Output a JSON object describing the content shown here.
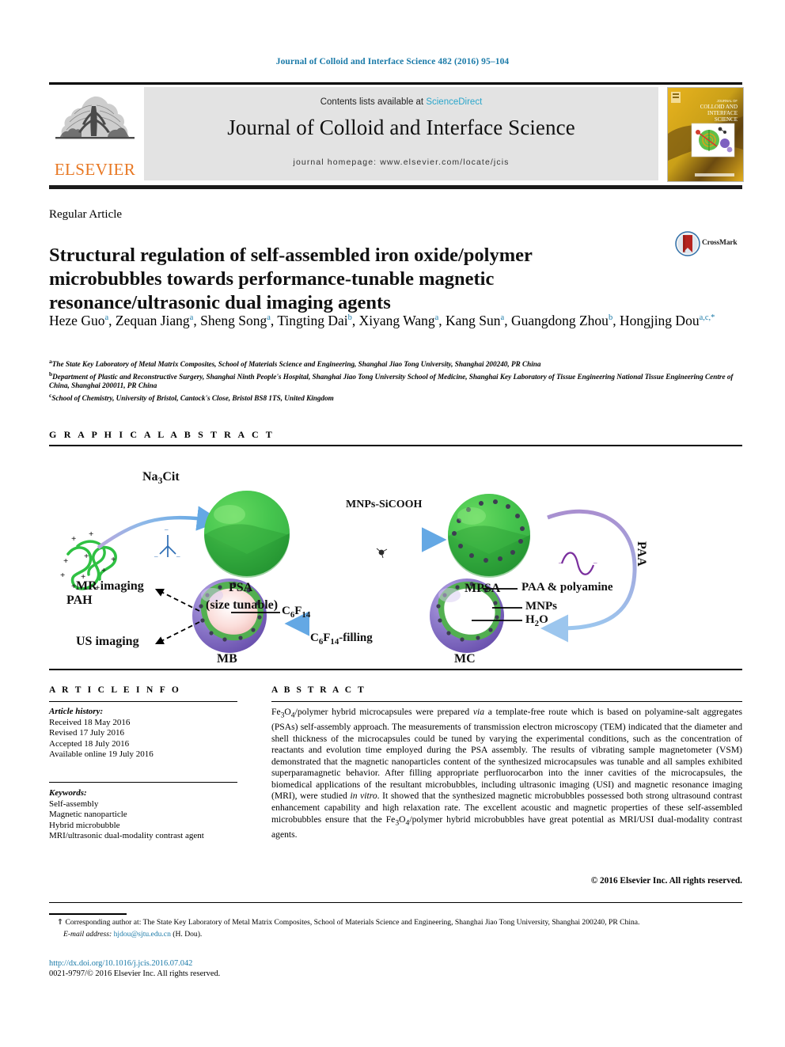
{
  "running_head": "Journal of Colloid and Interface Science 482 (2016) 95–104",
  "masthead": {
    "publisher": "ELSEVIER",
    "contents_prefix": "Contents lists available at ",
    "contents_link": "ScienceDirect",
    "journal_title": "Journal of Colloid and Interface Science",
    "homepage": "journal homepage: www.elsevier.com/locate/jcis",
    "cover_line1": "COLLOID AND",
    "cover_line2": "INTERFACE",
    "cover_line3": "SCIENCE"
  },
  "article": {
    "type": "Regular Article",
    "title": "Structural regulation of self-assembled iron oxide/polymer microbubbles towards performance-tunable magnetic resonance/ultrasonic dual imaging agents",
    "crossmark_label": "CrossMark"
  },
  "authors": [
    {
      "name": "Heze Guo",
      "sup": "a",
      "sep": ", "
    },
    {
      "name": "Zequan Jiang",
      "sup": "a",
      "sep": ", "
    },
    {
      "name": "Sheng Song",
      "sup": "a",
      "sep": ", "
    },
    {
      "name": "Tingting Dai",
      "sup": "b",
      "sep": ", "
    },
    {
      "name": "Xiyang Wang",
      "sup": "a",
      "sep": ", "
    },
    {
      "name": "Kang Sun",
      "sup": "a",
      "sep": ", "
    },
    {
      "name": "Guangdong Zhou",
      "sup": "b",
      "sep": ", "
    },
    {
      "name": "Hongjing Dou",
      "sup": "a,c,*",
      "sep": ""
    }
  ],
  "affiliations": [
    {
      "mark": "a",
      "text": "The State Key Laboratory of Metal Matrix Composites, School of Materials Science and Engineering, Shanghai Jiao Tong University, Shanghai 200240, PR China"
    },
    {
      "mark": "b",
      "text": "Department of Plastic and Reconstructive Surgery, Shanghai Ninth People's Hospital, Shanghai Jiao Tong University School of Medicine, Shanghai Key Laboratory of Tissue Engineering National Tissue Engineering Centre of China, Shanghai 200011, PR China"
    },
    {
      "mark": "c",
      "text": "School of Chemistry, University of Bristol, Cantock's Close, Bristol BS8 1TS, United Kingdom"
    }
  ],
  "graphical_abstract": {
    "heading": "G R A P H I C A L   A B S T R A C T",
    "labels": {
      "pah": "PAH",
      "na3cit": "Na3Cit",
      "psa": "PSA",
      "psa_sub": "(size tunable)",
      "mnps_sicooh": "MNPs-SiCOOH",
      "mpsa": "MPSA",
      "paa": "PAA",
      "mc": "MC",
      "mb": "MB",
      "paa_polyamine": "PAA & polyamine",
      "mnps": "MNPs",
      "h2o": "H2O",
      "c6f14": "C6F14",
      "c6f14_filling": "C6F14-filling",
      "mr_imaging": "MR imaging",
      "us_imaging": "US imaging"
    },
    "colors": {
      "green": "#3cb847",
      "green_dark": "#2e9a38",
      "purple": "#8a76c8",
      "arrow_blue": "#7ab4e8",
      "arrow_purple": "#9a6fc0",
      "pink": "#f3c9c6"
    }
  },
  "article_info": {
    "heading": "A R T I C L E   I N F O",
    "history_label": "Article history:",
    "history": [
      "Received 18 May 2016",
      "Revised 17 July 2016",
      "Accepted 18 July 2016",
      "Available online 19 July 2016"
    ],
    "keywords_label": "Keywords:",
    "keywords": [
      "Self-assembly",
      "Magnetic nanoparticle",
      "Hybrid microbubble",
      "MRI/ultrasonic dual-modality contrast agent"
    ]
  },
  "abstract": {
    "heading": "A B S T R A C T",
    "text": "Fe3O4/polymer hybrid microcapsules were prepared via a template-free route which is based on polyamine-salt aggregates (PSAs) self-assembly approach. The measurements of transmission electron microscopy (TEM) indicated that the diameter and shell thickness of the microcapsules could be tuned by varying the experimental conditions, such as the concentration of reactants and evolution time employed during the PSA assembly. The results of vibrating sample magnetometer (VSM) demonstrated that the magnetic nanoparticles content of the synthesized microcapsules was tunable and all samples exhibited superparamagnetic behavior. After filling appropriate perfluorocarbon into the inner cavities of the microcapsules, the biomedical applications of the resultant microbubbles, including ultrasonic imaging (USI) and magnetic resonance imaging (MRI), were studied in vitro. It showed that the synthesized magnetic microbubbles possessed both strong ultrasound contrast enhancement capability and high relaxation rate. The excellent acoustic and magnetic properties of these self-assembled microbubbles ensure that the Fe3O4/polymer hybrid microbubbles have great potential as MRI/USI dual-modality contrast agents.",
    "copyright": "© 2016 Elsevier Inc. All rights reserved."
  },
  "footer": {
    "corresponding_mark": "⇑",
    "corresponding_text": "Corresponding author at: The State Key Laboratory of Metal Matrix Composites, School of Materials Science and Engineering, Shanghai Jiao Tong University, Shanghai 200240, PR China.",
    "email_label": "E-mail address:",
    "email": "hjdou@sjtu.edu.cn",
    "email_suffix": "(H. Dou).",
    "doi": "http://dx.doi.org/10.1016/j.jcis.2016.07.042",
    "issn_line": "0021-9797/© 2016 Elsevier Inc. All rights reserved."
  }
}
